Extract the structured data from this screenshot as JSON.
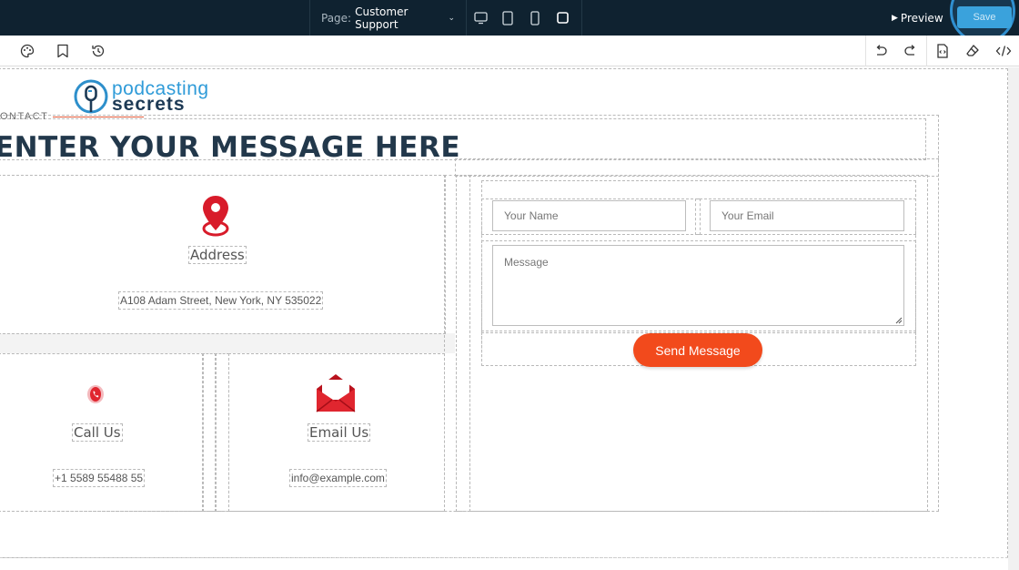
{
  "topbar": {
    "page_label": "Page:",
    "page_value": "Customer Support",
    "devices": [
      "desktop-icon",
      "tablet-icon",
      "mobile-icon",
      "fullscreen-icon"
    ],
    "preview_label": "Preview",
    "save_label": "Save"
  },
  "toolbar": {
    "left_icons": [
      "palette-icon",
      "bookmark-icon",
      "history-icon"
    ],
    "right_icons": [
      "undo-icon",
      "redo-icon",
      "code-file-icon",
      "eraser-icon",
      "code-icon"
    ]
  },
  "logo": {
    "line1": "podcasting",
    "line2": "secrets"
  },
  "section": {
    "label": "ONTACT",
    "headline": "ENTER YOUR MESSAGE HERE"
  },
  "address": {
    "title": "Address",
    "value": "A108 Adam Street, New York, NY 535022"
  },
  "call": {
    "title": "Call Us",
    "value": "+1 5589 55488 55"
  },
  "email": {
    "title": "Email Us",
    "value": "info@example.com"
  },
  "form": {
    "name_placeholder": "Your Name",
    "email_placeholder": "Your Email",
    "message_placeholder": "Message",
    "send_label": "Send Message"
  },
  "colors": {
    "topbar_bg": "#0f2230",
    "save_button": "#3aa2dc",
    "send_button": "#f24a1c",
    "headline": "#22384b",
    "icon_red": "#d81b2a"
  }
}
